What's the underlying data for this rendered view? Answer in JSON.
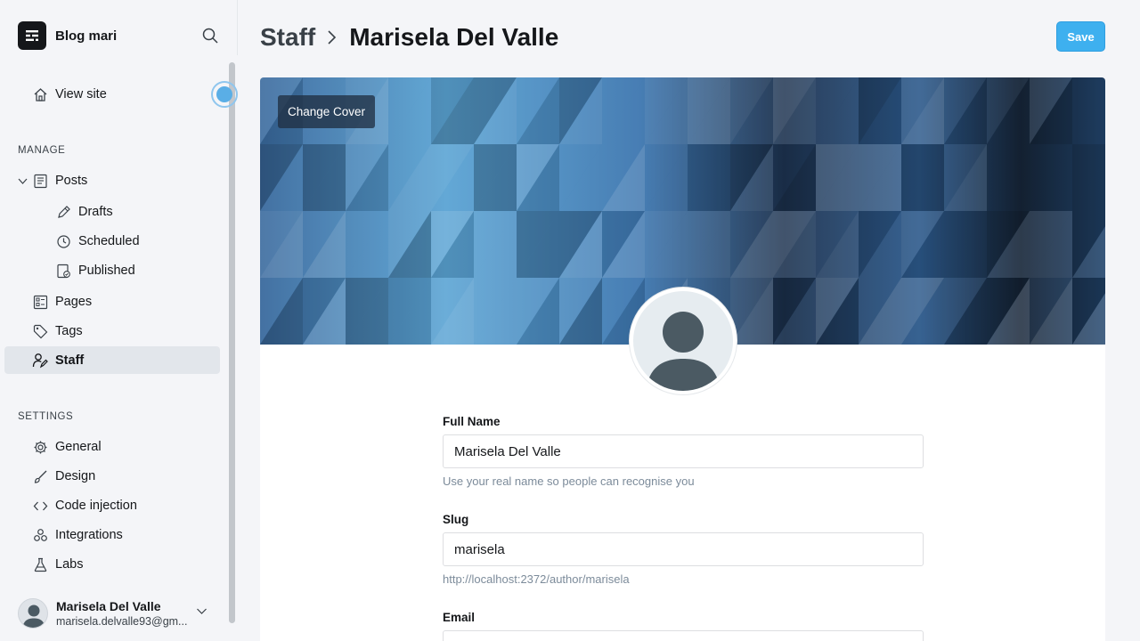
{
  "sidebar": {
    "blog_name": "Blog mari",
    "view_site": "View site",
    "manage_label": "MANAGE",
    "settings_label": "SETTINGS",
    "items": {
      "posts": "Posts",
      "drafts": "Drafts",
      "scheduled": "Scheduled",
      "published": "Published",
      "pages": "Pages",
      "tags": "Tags",
      "staff": "Staff",
      "general": "General",
      "design": "Design",
      "code_injection": "Code injection",
      "integrations": "Integrations",
      "labs": "Labs"
    },
    "user": {
      "name": "Marisela Del Valle",
      "email": "marisela.delvalle93@gm..."
    }
  },
  "header": {
    "breadcrumb_parent": "Staff",
    "breadcrumb_current": "Marisela Del Valle",
    "save_label": "Save"
  },
  "cover": {
    "change_cover_label": "Change Cover"
  },
  "form": {
    "full_name": {
      "label": "Full Name",
      "value": "Marisela Del Valle",
      "hint": "Use your real name so people can recognise you"
    },
    "slug": {
      "label": "Slug",
      "value": "marisela",
      "hint": "http://localhost:2372/author/marisela"
    },
    "email": {
      "label": "Email"
    }
  },
  "colors": {
    "accent": "#3eb0ef",
    "active_nav_bg": "#e2e6eb",
    "text": "#15171a"
  },
  "icons": [
    "ghost-logo-icon",
    "search-icon",
    "home-icon",
    "chevron-down-icon",
    "posts-icon",
    "pencil-icon",
    "clock-icon",
    "published-icon",
    "pages-icon",
    "tag-icon",
    "staff-icon",
    "gear-icon",
    "brush-icon",
    "code-icon",
    "integrations-icon",
    "flask-icon",
    "chevron-right-icon",
    "avatar-placeholder-icon"
  ]
}
